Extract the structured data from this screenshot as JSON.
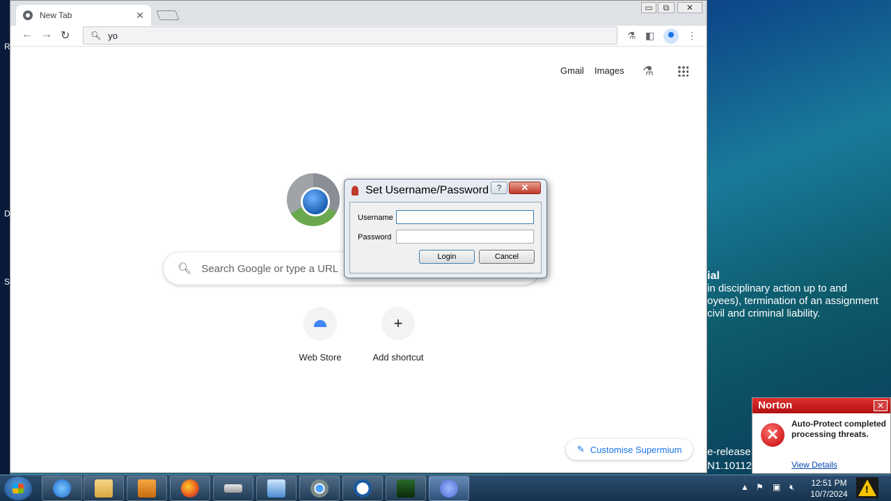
{
  "desktop": {
    "notice_title": "ial",
    "notice_lines": [
      "in disciplinary action up to and",
      "oyees), termination of an assignment",
      "civil and criminal liability."
    ],
    "notice_lower_lines": [
      "e-release",
      "N1.10112"
    ],
    "edge_letters": [
      "R",
      "D",
      "S"
    ]
  },
  "browser": {
    "tab_title": "New Tab",
    "tab_close": "✕",
    "window_buttons": {
      "minimize": "▭",
      "maximize": "⧉",
      "close": "✕"
    },
    "omnibox_value": "yo",
    "ntp": {
      "links": {
        "gmail": "Gmail",
        "images": "Images"
      },
      "search_placeholder": "Search Google or type a URL",
      "shortcuts": [
        {
          "label": "Web Store"
        },
        {
          "label": "Add shortcut",
          "icon": "+"
        }
      ],
      "customise_label": "Customise Supermium"
    }
  },
  "dialog": {
    "title": "Set Username/Password",
    "help": "?",
    "close": "✕",
    "username_label": "Username",
    "password_label": "Password",
    "username_value": "",
    "password_value": "",
    "login_label": "Login",
    "cancel_label": "Cancel"
  },
  "norton": {
    "brand": "Norton",
    "close": "✕",
    "message": "Auto-Protect completed processing threats.",
    "link": "View Details"
  },
  "taskbar": {
    "time": "12:51 PM",
    "date": "10/7/2024",
    "items": [
      "internet-explorer",
      "file-explorer",
      "media-player",
      "firefox",
      "drive",
      "control-panel",
      "supermium",
      "panda",
      "terminal",
      "bird-app"
    ]
  },
  "colors": {
    "accent": "#1a73e8",
    "norton_red": "#c0392b",
    "taskbar": "#16324d"
  }
}
